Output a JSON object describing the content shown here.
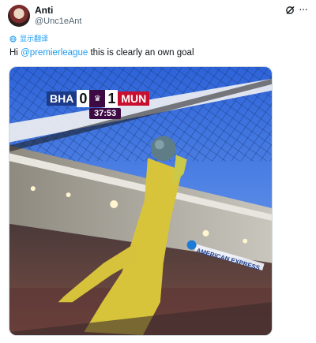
{
  "author": {
    "display_name": "Anti",
    "handle": "@Unc1eAnt"
  },
  "header_icons": {
    "grok": "grok-icon",
    "more": "more-icon",
    "more_glyph": "···"
  },
  "translate": {
    "label": "显示翻译"
  },
  "tweet": {
    "prefix": "Hi ",
    "mention": "@premierleague",
    "suffix": " this is clearly an own goal"
  },
  "media": {
    "scoreboard": {
      "home_team": "BHA",
      "home_score": "0",
      "away_score": "1",
      "away_team": "MUN",
      "clock": "37:53"
    },
    "stadium_sign": "AMERICAN EXPRESS"
  },
  "colors": {
    "link": "#1d9bf0",
    "home": "#1b3a87",
    "away": "#c8102e",
    "pl_purple": "#3d0a44"
  }
}
